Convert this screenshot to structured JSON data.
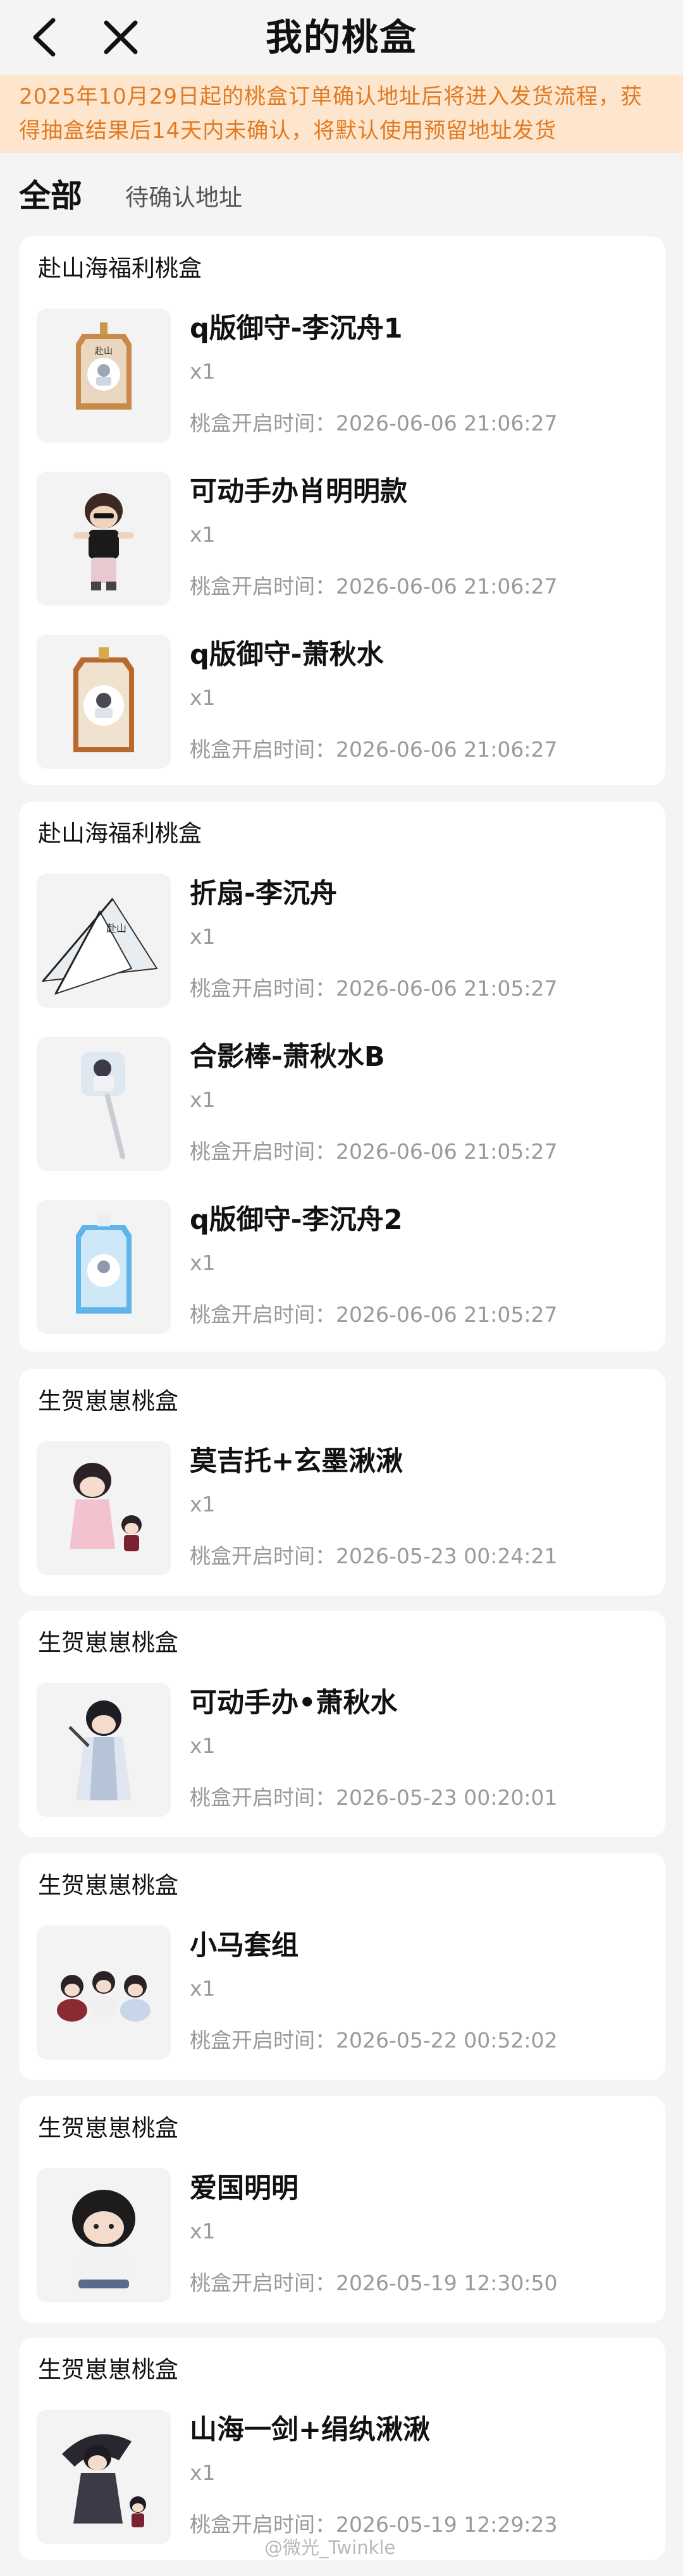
{
  "header": {
    "title": "我的桃盒"
  },
  "notice": "2025年10月29日起的桃盒订单确认地址后将进入发货流程，获得抽盒结果后14天内未确认，将默认使用预留地址发货",
  "tabs": [
    {
      "label": "全部",
      "active": true
    },
    {
      "label": "待确认地址",
      "active": false
    }
  ],
  "cards": [
    {
      "title": "赴山海福利桃盒",
      "items": [
        {
          "name": "q版御守-李沉舟1",
          "qty": "x1",
          "time_label": "桃盒开启时间：",
          "time": "2026-06-06 21:06:27",
          "icon": "amulet-tan-thumbnail"
        },
        {
          "name": "可动手办肖明明款",
          "qty": "x1",
          "time_label": "桃盒开启时间：",
          "time": "2026-06-06 21:06:27",
          "icon": "figure-boy-thumbnail"
        },
        {
          "name": "q版御守-萧秋水",
          "qty": "x1",
          "time_label": "桃盒开启时间：",
          "time": "2026-06-06 21:06:27",
          "icon": "amulet-brown-thumbnail"
        }
      ]
    },
    {
      "title": "赴山海福利桃盒",
      "items": [
        {
          "name": "折扇-李沉舟",
          "qty": "x1",
          "time_label": "桃盒开启时间：",
          "time": "2026-06-06 21:05:27",
          "icon": "folding-fan-thumbnail"
        },
        {
          "name": "合影棒-萧秋水B",
          "qty": "x1",
          "time_label": "桃盒开启时间：",
          "time": "2026-06-06 21:05:27",
          "icon": "photo-stick-thumbnail"
        },
        {
          "name": "q版御守-李沉舟2",
          "qty": "x1",
          "time_label": "桃盒开启时间：",
          "time": "2026-06-06 21:05:27",
          "icon": "amulet-blue-thumbnail"
        }
      ]
    },
    {
      "title": "生贺崽崽桃盒",
      "items": [
        {
          "name": "莫吉托+玄墨湫湫",
          "qty": "x1",
          "time_label": "桃盒开启时间：",
          "time": "2026-05-23 00:24:21",
          "icon": "figure-pink-thumbnail"
        }
      ]
    },
    {
      "title": "生贺崽崽桃盒",
      "items": [
        {
          "name": "可动手办•萧秋水",
          "qty": "x1",
          "time_label": "桃盒开启时间：",
          "time": "2026-05-23 00:20:01",
          "icon": "figure-swordsman-thumbnail"
        }
      ]
    },
    {
      "title": "生贺崽崽桃盒",
      "items": [
        {
          "name": "小马套组",
          "qty": "x1",
          "time_label": "桃盒开启时间：",
          "time": "2026-05-22 00:52:02",
          "icon": "pony-set-thumbnail"
        }
      ]
    },
    {
      "title": "生贺崽崽桃盒",
      "items": [
        {
          "name": "爱国明明",
          "qty": "x1",
          "time_label": "桃盒开启时间：",
          "time": "2026-05-19 12:30:50",
          "icon": "figure-fluffy-thumbnail"
        }
      ]
    },
    {
      "title": "生贺崽崽桃盒",
      "items": [
        {
          "name": "山海一剑+绢纨湫湫",
          "qty": "x1",
          "time_label": "桃盒开启时间：",
          "time": "2026-05-19 12:29:23",
          "icon": "figure-dark-thumbnail"
        }
      ]
    }
  ],
  "watermark": "@微光_Twinkle",
  "colors": {
    "accent_orange": "#e17a22",
    "notice_bg": "#fde6cd",
    "page_bg": "#f4f4f4",
    "card_bg": "#ffffff",
    "muted_text": "#9a9a9a"
  }
}
